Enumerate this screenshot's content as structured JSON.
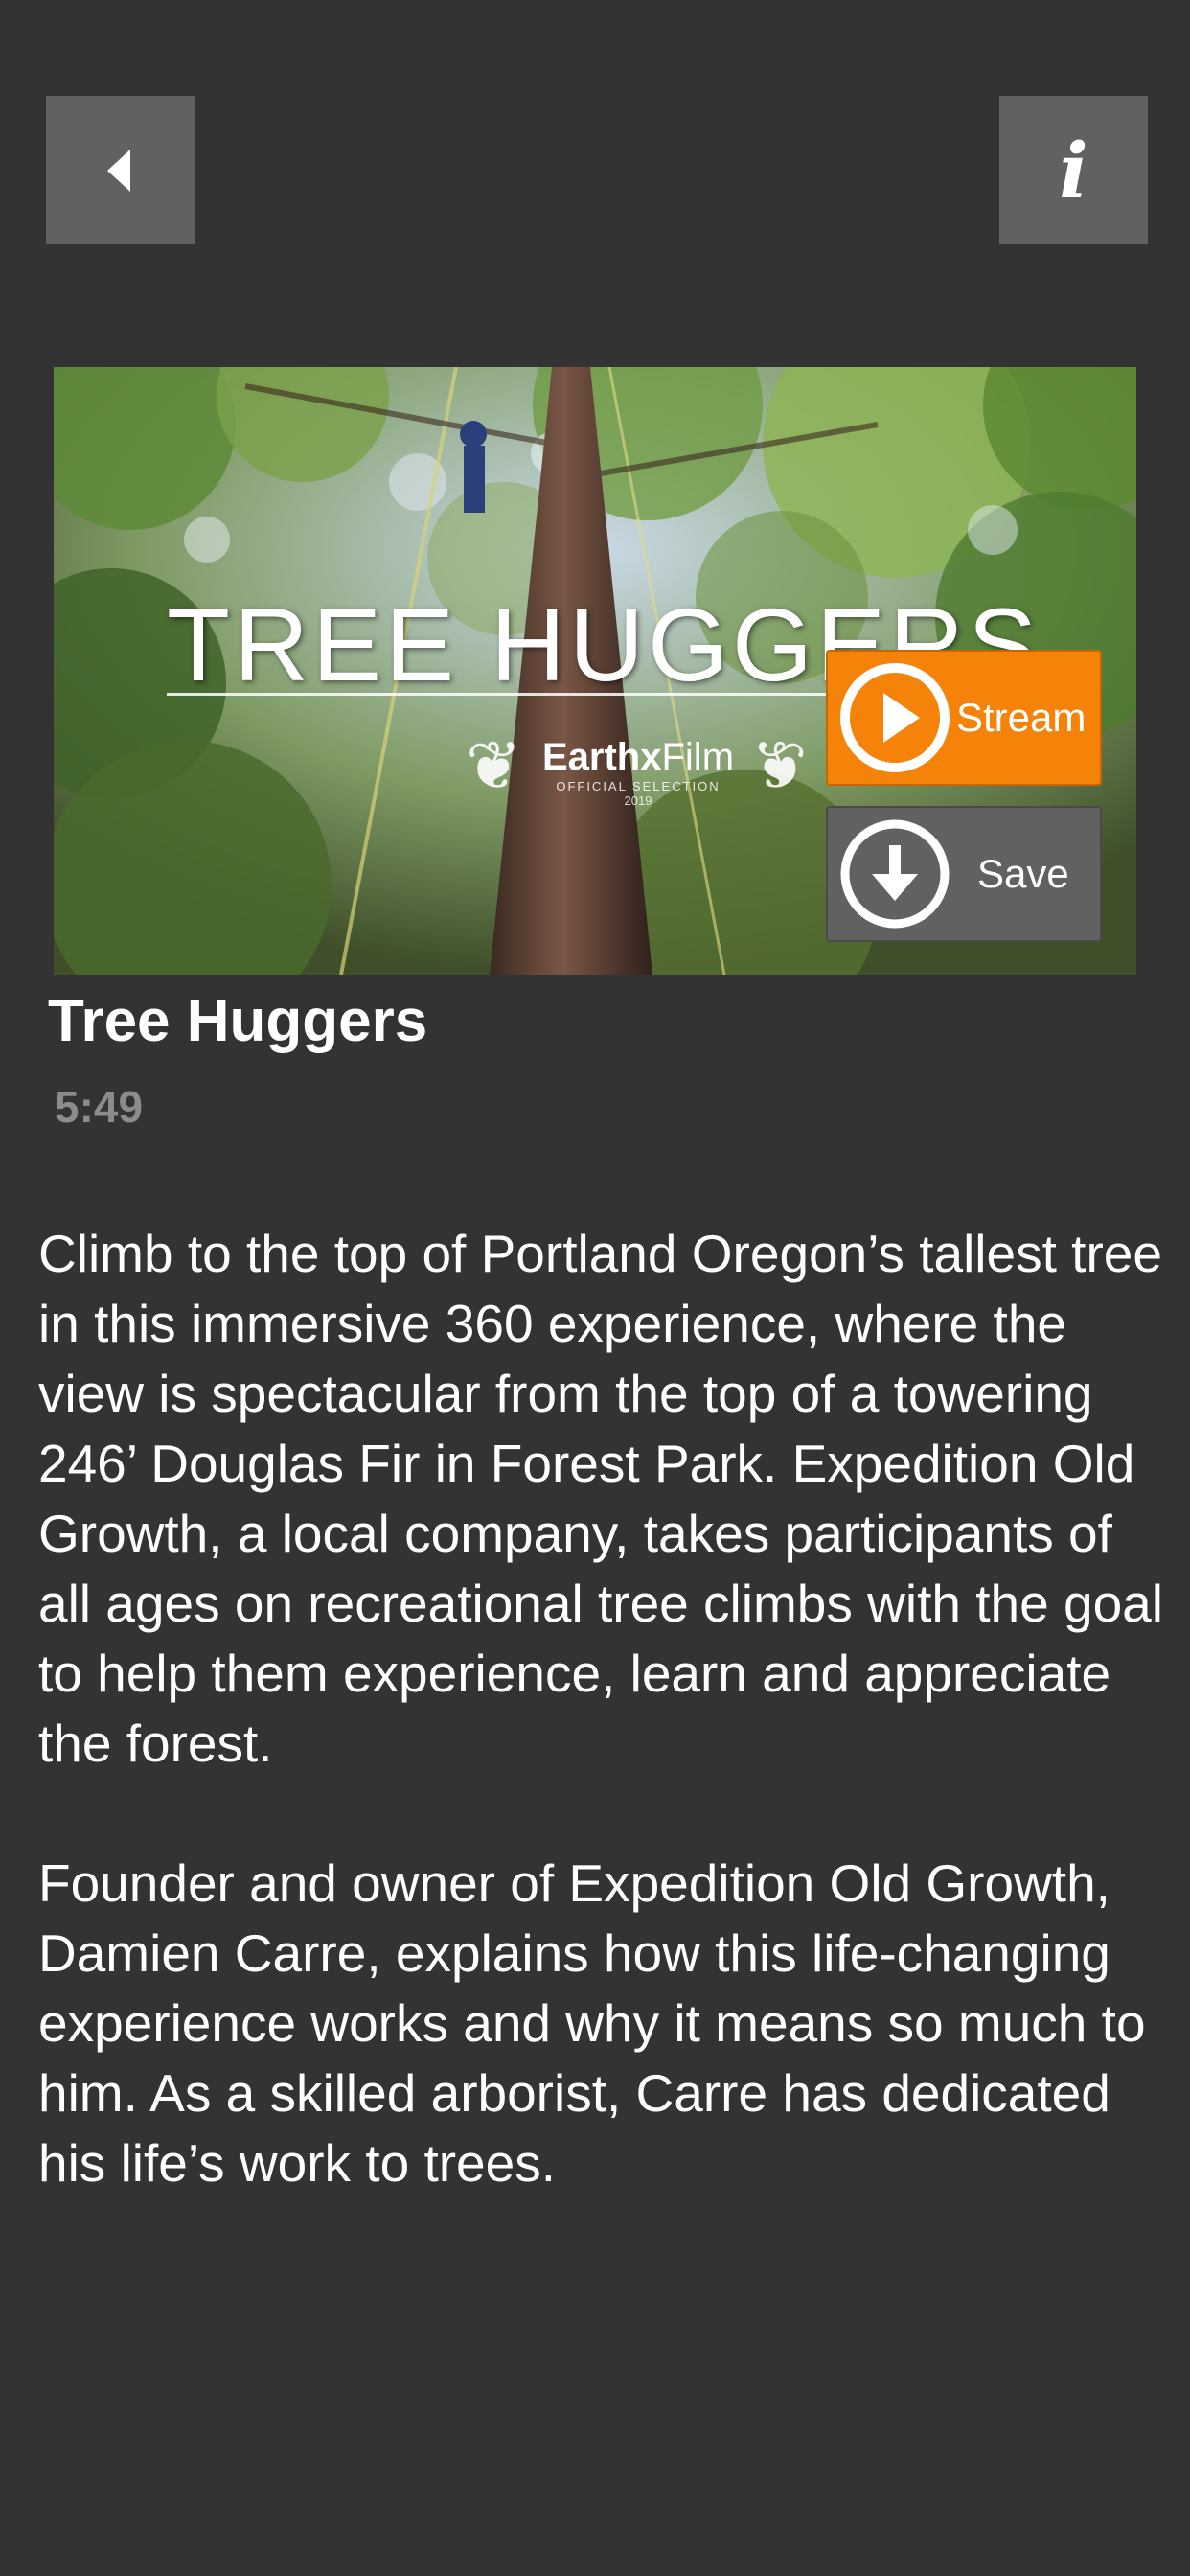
{
  "nav": {
    "back_icon": "back-arrow-icon",
    "info_icon": "info-icon",
    "info_glyph": "i"
  },
  "video": {
    "thumbnail_title": "TREE HUGGERS",
    "festival_name_bold": "Earthx",
    "festival_name_light": "Film",
    "festival_sub": "OFFICIAL SELECTION",
    "festival_year": "2019",
    "title": "Tree Huggers",
    "duration": "5:49"
  },
  "actions": {
    "stream_label": "Stream",
    "stream_icon": "play-circle-icon",
    "save_label": "Save",
    "save_icon": "download-circle-icon"
  },
  "description": {
    "paragraphs": [
      "Climb to the top of Portland Oregon’s tallest tree in this immersive 360 experience, where the view is spectacular from the top of a towering 246’ Douglas Fir in Forest Park. Expedition Old Growth, a local company, takes participants of all ages on recreational tree climbs with the goal to help them experience, learn and appreciate the forest.",
      "Founder and owner of Expedition Old Growth, Damien Carre, explains how this life-changing experience works and why it means so much to him. As a skilled arborist, Carre has dedicated his life’s work to trees."
    ]
  },
  "colors": {
    "background": "#333333",
    "nav_button": "#616161",
    "stream_accent": "#f5830a",
    "save_button": "#616161",
    "duration_text": "#8c8c8c"
  }
}
